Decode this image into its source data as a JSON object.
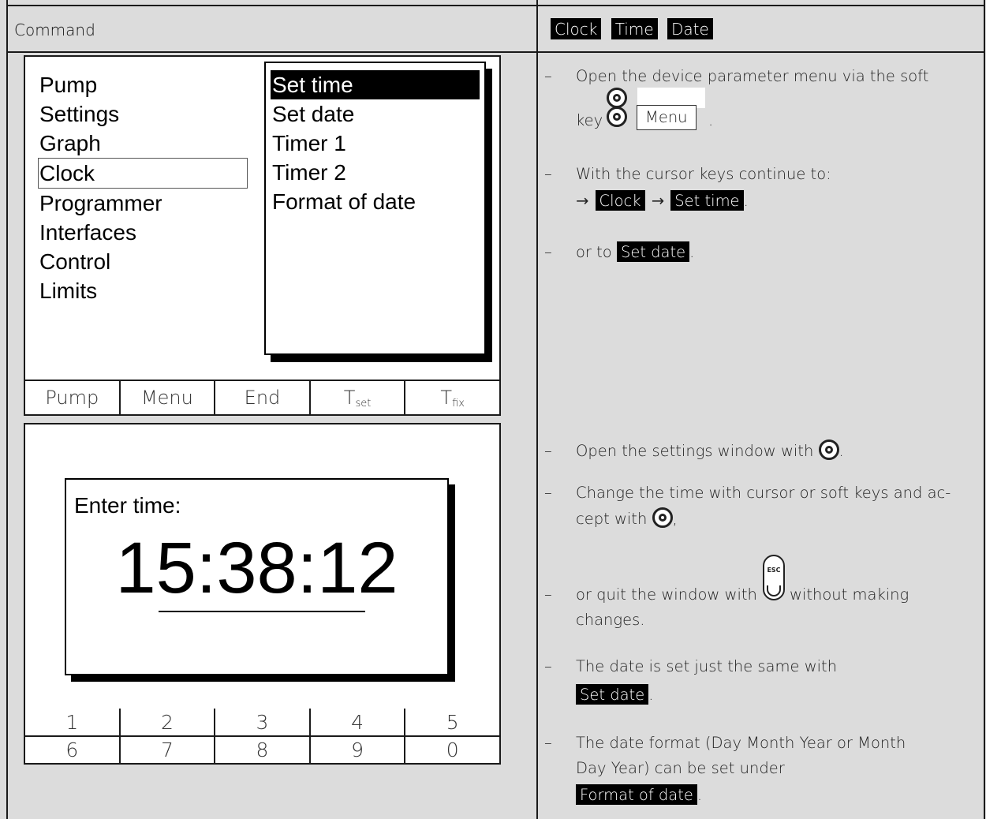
{
  "header": {
    "command_label": "Command",
    "tags": [
      "Clock",
      "Time",
      "Date"
    ]
  },
  "menu_screen": {
    "left_items": [
      "Pump",
      "Settings",
      "Graph",
      "Clock",
      "Programmer",
      "Interfaces",
      "Control",
      "Limits"
    ],
    "selected_left": "Clock",
    "submenu_items": [
      "Set time",
      "Set date",
      "Timer 1",
      "Timer 2",
      "Format of date"
    ],
    "selected_submenu": "Set time",
    "softkeys": [
      "Pump",
      "Menu",
      "End",
      "T",
      "T"
    ],
    "softkey_subscripts": [
      "",
      "",
      "",
      "set",
      "fix"
    ]
  },
  "time_screen": {
    "dialog_label": "Enter time:",
    "time_value": "15:38:12",
    "numpad_row1": [
      "1",
      "2",
      "3",
      "4",
      "5"
    ],
    "numpad_row2": [
      "6",
      "7",
      "8",
      "9",
      "0"
    ]
  },
  "instructions_top": {
    "dash": "–",
    "step1_text": "Open the device parameter menu via the soft",
    "step1_key": "key",
    "step1_button": "Menu",
    "step1_end": ".",
    "step2_text": "With the cursor keys continue to:",
    "arrow": "→",
    "step2_tag1": "Clock",
    "step2_tag2": "Set time",
    "step2_end": ".",
    "step3_text": "or to",
    "step3_tag": "Set date",
    "step3_end": "."
  },
  "instructions_bottom": {
    "step1_text": "Open the settings window with",
    "step1_end": ".",
    "step2_line1": "Change the time with cursor or soft keys and ac-",
    "step2_line2": "cept with",
    "step2_end": ",",
    "step3_text": "or quit the window with",
    "step3_after": "without making",
    "step3_line2": "changes.",
    "esc_label": "ESC",
    "step4_text": "The date is set just the same with",
    "step4_tag": "Set date",
    "step4_end": ".",
    "step5_line1": "The date format (Day Month Year or Month",
    "step5_line2": "Day Year) can be set under",
    "step5_tag": "Format of date",
    "step5_end": "."
  }
}
